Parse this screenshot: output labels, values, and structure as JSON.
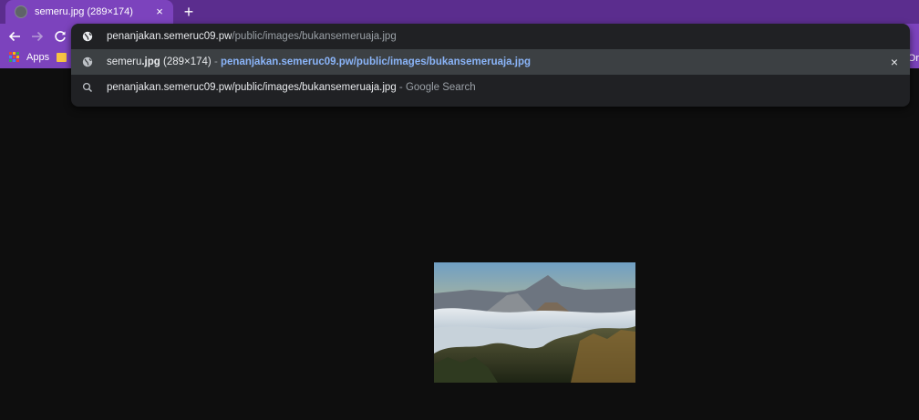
{
  "tab": {
    "title": "semeru.jpg (289×174)",
    "close": "×"
  },
  "new_tab": "+",
  "toolbar": {
    "back_icon": "arrow-left-icon",
    "forward_icon": "arrow-right-icon",
    "reload_icon": "reload-icon"
  },
  "bookmarks": {
    "apps_label": "Apps",
    "apps_colors": [
      "#ea4335",
      "#fbbc05",
      "#34a853",
      "#4285f4",
      "#ea4335",
      "#fbbc05",
      "#34a853",
      "#4285f4",
      "#ea4335"
    ],
    "trailing_label": "Or"
  },
  "omnibox": {
    "input": {
      "host": "penanjakan.semeruc09.pw",
      "path": "/public/images/bukansemeruaja.jpg",
      "icon": "globe-icon"
    },
    "suggestions": [
      {
        "name_plain": "semeru",
        "name_bold": ".jpg",
        "dims": " (289×174)",
        "separator": " - ",
        "url": "penanjakan.semeruc09.pw/public/images/bukansemeruaja.jpg",
        "icon": "globe-icon",
        "remove": "×"
      },
      {
        "query": "penanjakan.semeruc09.pw/public/images/bukansemeruaja.jpg",
        "suffix": " - Google Search",
        "icon": "search-icon"
      }
    ]
  },
  "colors": {
    "frame": "#5b2d8e",
    "toolbar": "#7c43bd",
    "omnibox_bg": "#202124",
    "selected_row": "#3c4043",
    "link": "#8ab4f8",
    "page_bg": "#0e0e0e"
  }
}
